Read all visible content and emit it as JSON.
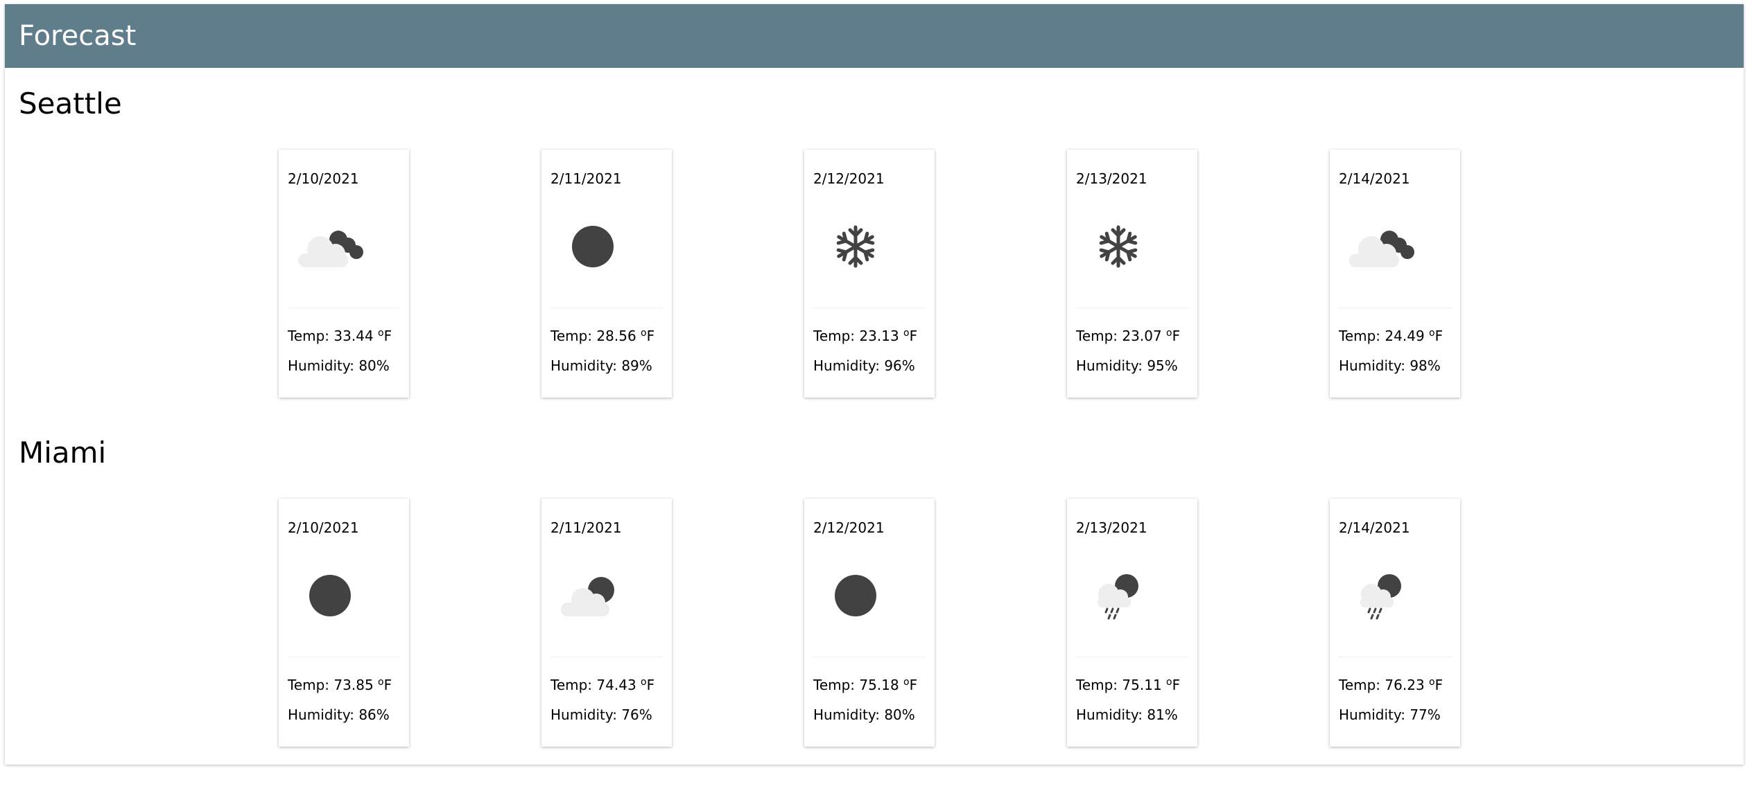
{
  "header": {
    "title": "Forecast"
  },
  "labels": {
    "temp_prefix": "Temp: ",
    "temp_unit": "F",
    "degree_symbol": "o",
    "humidity_prefix": "Humidity: "
  },
  "colors": {
    "header_bg": "#607d8b",
    "icon_dark": "#424242",
    "icon_light": "#eeeeee"
  },
  "cities": [
    {
      "name": "Seattle",
      "days": [
        {
          "date": "2/10/2021",
          "icon": "cloudy-icon",
          "temp": "33.44",
          "humidity": "80%"
        },
        {
          "date": "2/11/2021",
          "icon": "clear-icon",
          "temp": "28.56",
          "humidity": "89%"
        },
        {
          "date": "2/12/2021",
          "icon": "snowflake-icon",
          "temp": "23.13",
          "humidity": "96%"
        },
        {
          "date": "2/13/2021",
          "icon": "snowflake-icon",
          "temp": "23.07",
          "humidity": "95%"
        },
        {
          "date": "2/14/2021",
          "icon": "cloudy-icon",
          "temp": "24.49",
          "humidity": "98%"
        }
      ]
    },
    {
      "name": "Miami",
      "days": [
        {
          "date": "2/10/2021",
          "icon": "clear-icon",
          "temp": "73.85",
          "humidity": "86%"
        },
        {
          "date": "2/11/2021",
          "icon": "partly-cloudy-icon",
          "temp": "74.43",
          "humidity": "76%"
        },
        {
          "date": "2/12/2021",
          "icon": "clear-icon",
          "temp": "75.18",
          "humidity": "80%"
        },
        {
          "date": "2/13/2021",
          "icon": "rain-icon",
          "temp": "75.11",
          "humidity": "81%"
        },
        {
          "date": "2/14/2021",
          "icon": "rain-icon",
          "temp": "76.23",
          "humidity": "77%"
        }
      ]
    }
  ]
}
